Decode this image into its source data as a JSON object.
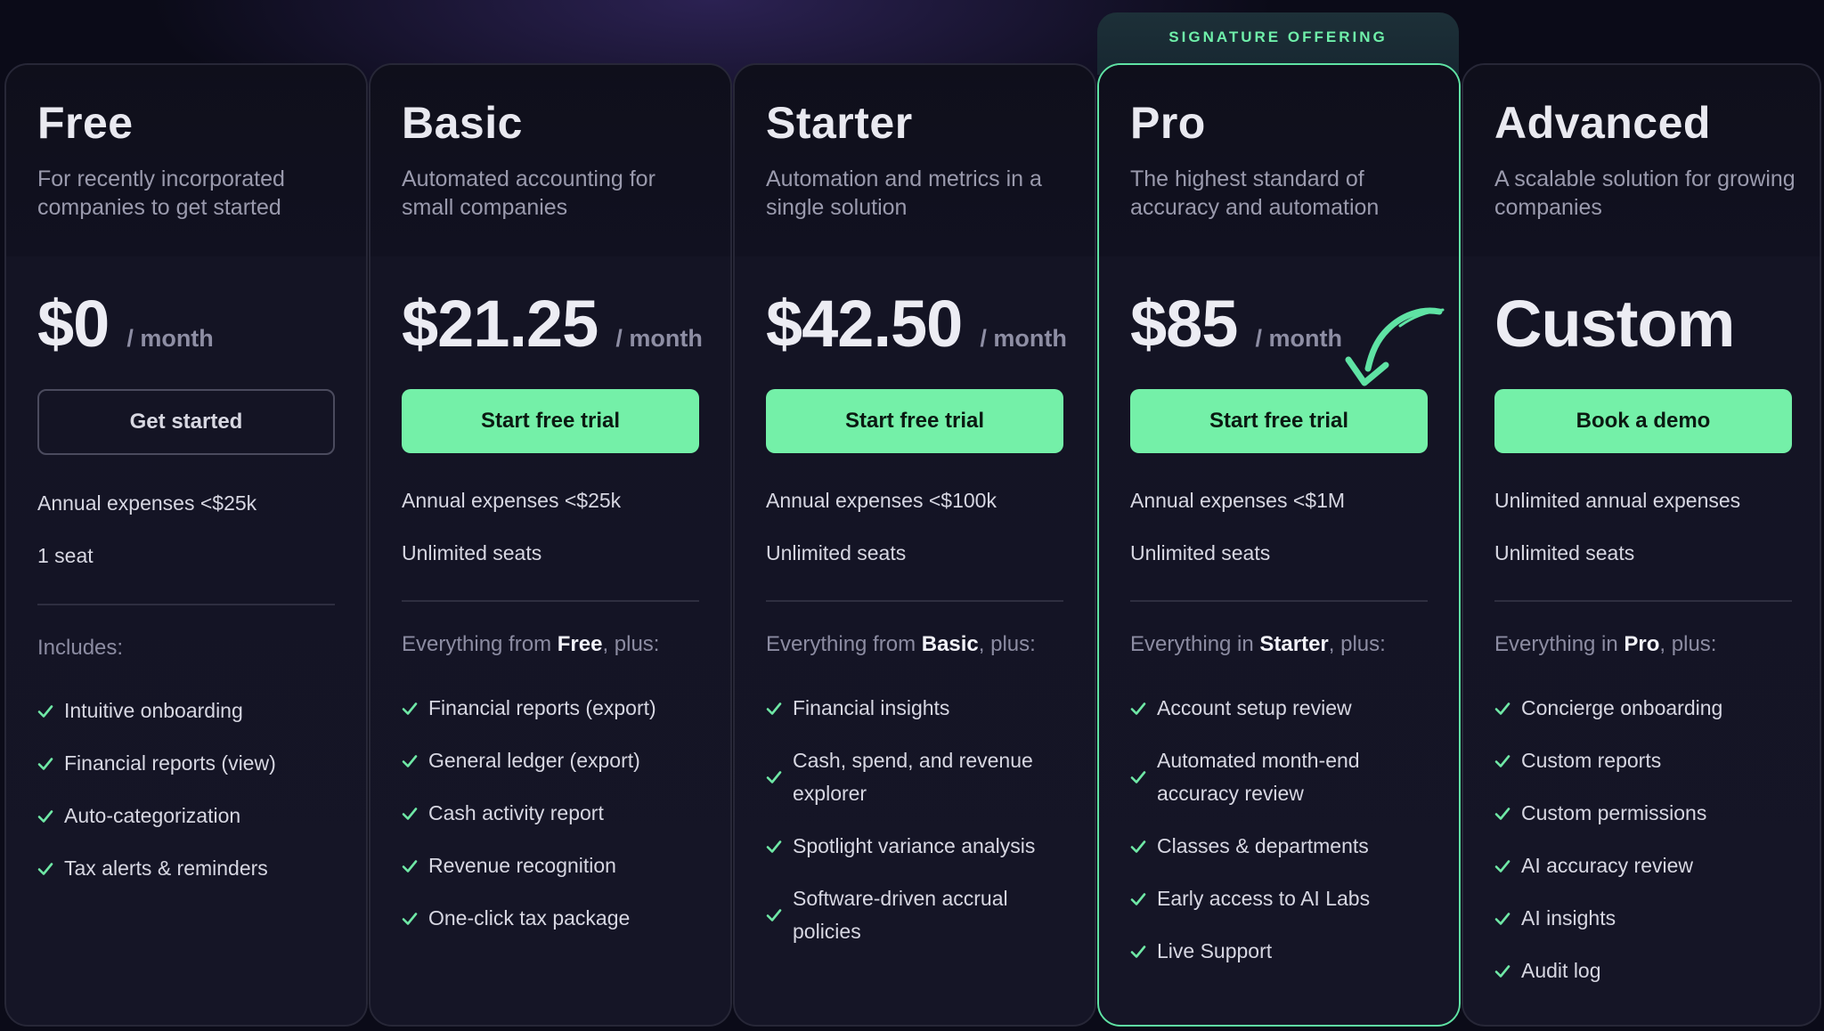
{
  "badge": "SIGNATURE OFFERING",
  "plans": [
    {
      "name": "Free",
      "description": "For recently incorporated companies to get started",
      "price": "$0",
      "period": "/ month",
      "cta": "Get started",
      "limits": [
        "Annual expenses <$25k",
        "1 seat"
      ],
      "includes_prefix": "Includes:",
      "includes_bold": "",
      "includes_suffix": "",
      "features": [
        "Intuitive onboarding",
        "Financial reports (view)",
        "Auto-categorization",
        "Tax alerts & reminders"
      ]
    },
    {
      "name": "Basic",
      "description": "Automated accounting for small companies",
      "price": "$21.25",
      "period": "/ month",
      "cta": "Start free trial",
      "limits": [
        "Annual expenses <$25k",
        "Unlimited seats"
      ],
      "includes_prefix": "Everything from ",
      "includes_bold": "Free",
      "includes_suffix": ", plus:",
      "features": [
        "Financial reports (export)",
        "General ledger (export)",
        "Cash activity report",
        "Revenue recognition",
        "One-click tax package"
      ]
    },
    {
      "name": "Starter",
      "description": "Automation and metrics in a single solution",
      "price": "$42.50",
      "period": "/ month",
      "cta": "Start free trial",
      "limits": [
        "Annual expenses <$100k",
        "Unlimited seats"
      ],
      "includes_prefix": "Everything from ",
      "includes_bold": "Basic",
      "includes_suffix": ", plus:",
      "features": [
        "Financial insights",
        "Cash, spend, and revenue explorer",
        "Spotlight variance analysis",
        "Software-driven accrual policies"
      ]
    },
    {
      "name": "Pro",
      "description": "The highest standard of accuracy and  automation",
      "price": "$85",
      "period": "/ month",
      "cta": "Start free trial",
      "limits": [
        "Annual expenses <$1M",
        "Unlimited seats"
      ],
      "includes_prefix": "Everything in ",
      "includes_bold": "Starter",
      "includes_suffix": ", plus:",
      "features": [
        "Account setup review",
        "Automated month-end accuracy review",
        "Classes & departments",
        "Early access to AI Labs",
        "Live Support"
      ]
    },
    {
      "name": "Advanced",
      "description": "A scalable solution for growing companies",
      "price": "Custom",
      "period": "",
      "cta": "Book a demo",
      "limits": [
        "Unlimited annual expenses",
        "Unlimited seats"
      ],
      "includes_prefix": "Everything in ",
      "includes_bold": "Pro",
      "includes_suffix": ", plus:",
      "features": [
        "Concierge onboarding",
        "Custom reports",
        "Custom permissions",
        "AI accuracy review",
        "AI insights",
        "Audit log"
      ]
    }
  ],
  "colors": {
    "accent": "#74f0a8",
    "background": "#0b0b18",
    "card": "#141424",
    "featured_border": "#5fe3a4"
  }
}
